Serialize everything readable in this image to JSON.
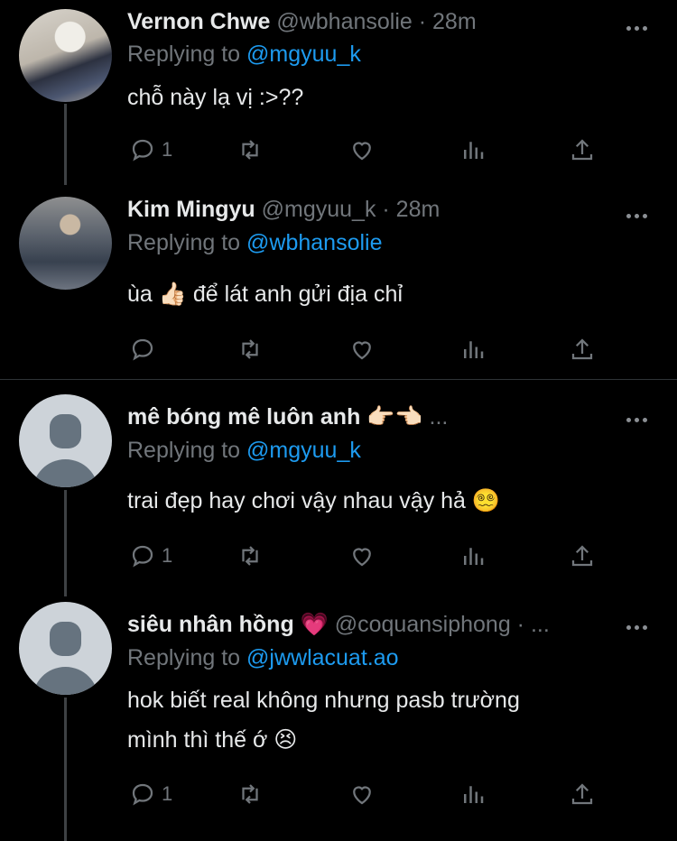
{
  "tweets": [
    {
      "name": "Vernon Chwe",
      "handle": "@wbhansolie",
      "time": "· 28m",
      "replying_label": "Replying to",
      "replying_to": "@mgyuu_k",
      "text": "chỗ này lạ vị :>??",
      "reply_count": "1",
      "avatar": "photo"
    },
    {
      "name": "Kim Mingyu",
      "handle": "@mgyuu_k",
      "time": "· 28m",
      "replying_label": "Replying to",
      "replying_to": "@wbhansolie",
      "text": "ùa 👍🏻 để lát anh gửi địa chỉ",
      "reply_count": "",
      "avatar": "photo"
    },
    {
      "name": "mê bóng mê luôn anh 👉🏻👈🏻",
      "handle": "...",
      "time": "",
      "replying_label": "Replying to",
      "replying_to": "@mgyuu_k",
      "text": "trai đẹp hay chơi vậy nhau vậy hả 😵‍💫",
      "reply_count": "1",
      "avatar": "default"
    },
    {
      "name": "siêu nhân hồng 💗",
      "handle": "@coquansiphong · ...",
      "time": "",
      "replying_label": "Replying to",
      "replying_to": "@jwwlacuat.ao",
      "text_line1": "hok biết real không nhưng pasb trường",
      "text_line2": "mình thì thế ớ 😣",
      "reply_count": "1",
      "avatar": "default"
    }
  ],
  "icons": [
    "reply-icon",
    "retweet-icon",
    "like-icon",
    "stats-icon",
    "share-icon",
    "more-icon"
  ],
  "colors": {
    "background": "#000000",
    "text": "#e7e9ea",
    "muted": "#71767b",
    "link": "#1d9bf0"
  }
}
